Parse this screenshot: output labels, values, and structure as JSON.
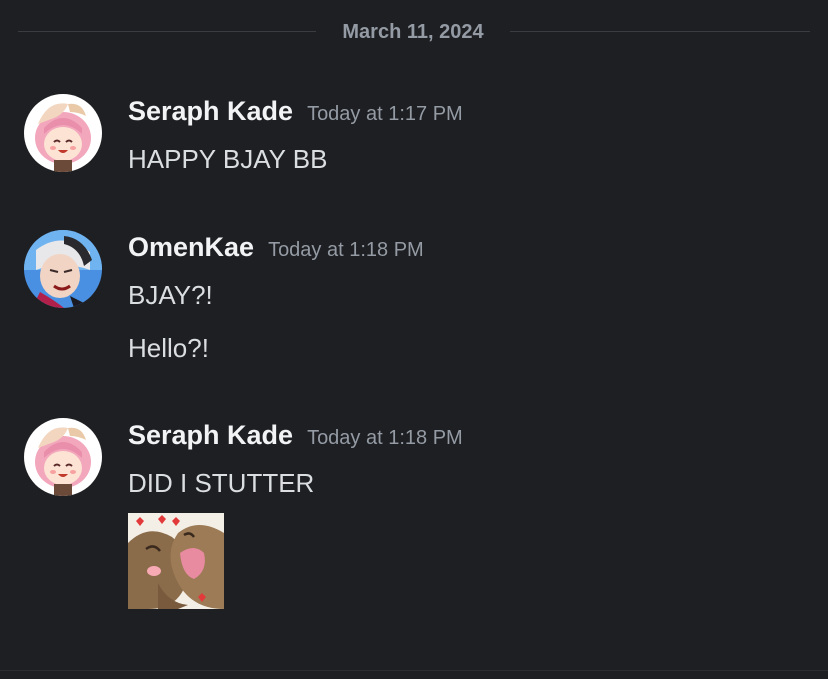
{
  "date_divider": "March 11, 2024",
  "messages": [
    {
      "username": "Seraph Kade",
      "timestamp": "Today at 1:17 PM",
      "lines": [
        "HAPPY BJAY BB"
      ],
      "avatar": "anime-pink-hair-avatar"
    },
    {
      "username": "OmenKae",
      "timestamp": "Today at 1:18 PM",
      "lines": [
        "BJAY?!",
        "Hello?!"
      ],
      "avatar": "anime-white-hair-avatar"
    },
    {
      "username": "Seraph Kade",
      "timestamp": "Today at 1:18 PM",
      "lines": [
        "DID I STUTTER"
      ],
      "avatar": "anime-pink-hair-avatar",
      "sticker": "hug-sticker"
    }
  ],
  "colors": {
    "background": "#1e1f22",
    "username": "#f2f3f5",
    "timestamp": "#949ba4",
    "text": "#dbdee1",
    "divider": "#3a3c42"
  }
}
